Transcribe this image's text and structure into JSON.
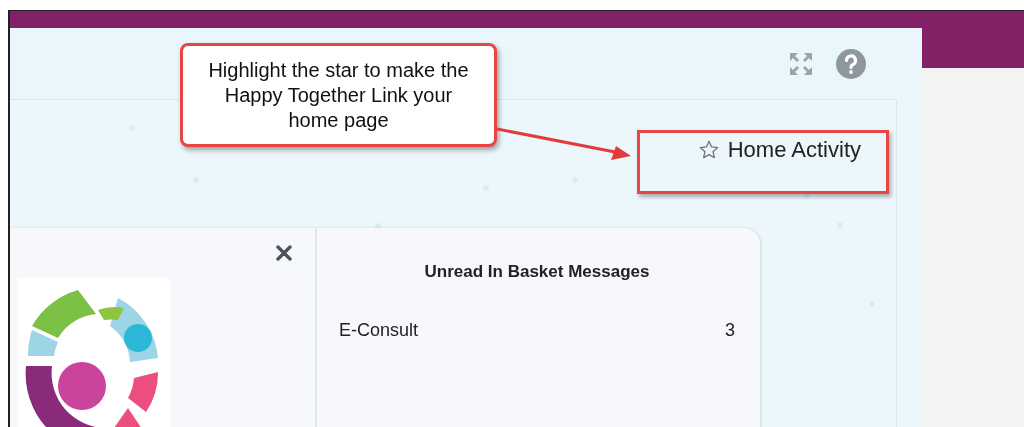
{
  "toolbar": {
    "icons": [
      {
        "kind": "expand"
      },
      {
        "kind": "help"
      }
    ]
  },
  "home_activity": {
    "label": "Home Activity",
    "favorite": false
  },
  "callout": {
    "text": "Highlight the star to make the Happy Together Link your home page"
  },
  "card": {
    "title": "Unread In Basket Messages",
    "rows": [
      {
        "label": "E-Consult",
        "count": "3"
      }
    ]
  }
}
